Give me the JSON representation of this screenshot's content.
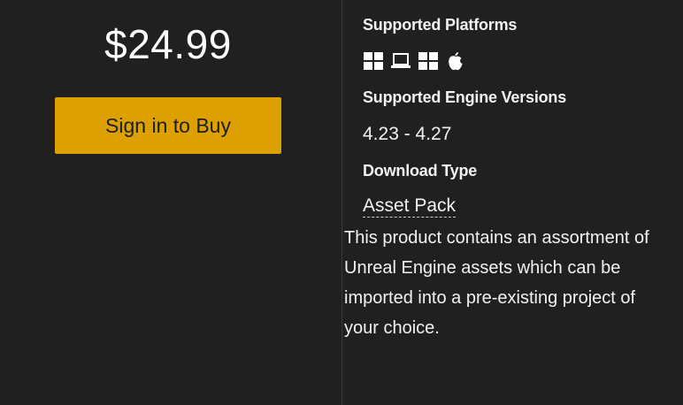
{
  "purchase": {
    "price": "$24.99",
    "buy_label": "Sign in to Buy"
  },
  "details": {
    "platforms_title": "Supported Platforms",
    "platform_icons": [
      "windows-icon",
      "laptop-icon",
      "windows-icon",
      "apple-icon"
    ],
    "engine_versions_title": "Supported Engine Versions",
    "engine_versions": "4.23 - 4.27",
    "download_type_title": "Download Type",
    "download_type": "Asset Pack",
    "description": "This product contains an assortment of Unreal Engine assets which can be imported into a pre-existing project of your choice."
  },
  "colors": {
    "background": "#202020",
    "accent_button": "#dca100",
    "text": "#f2f2f2"
  }
}
